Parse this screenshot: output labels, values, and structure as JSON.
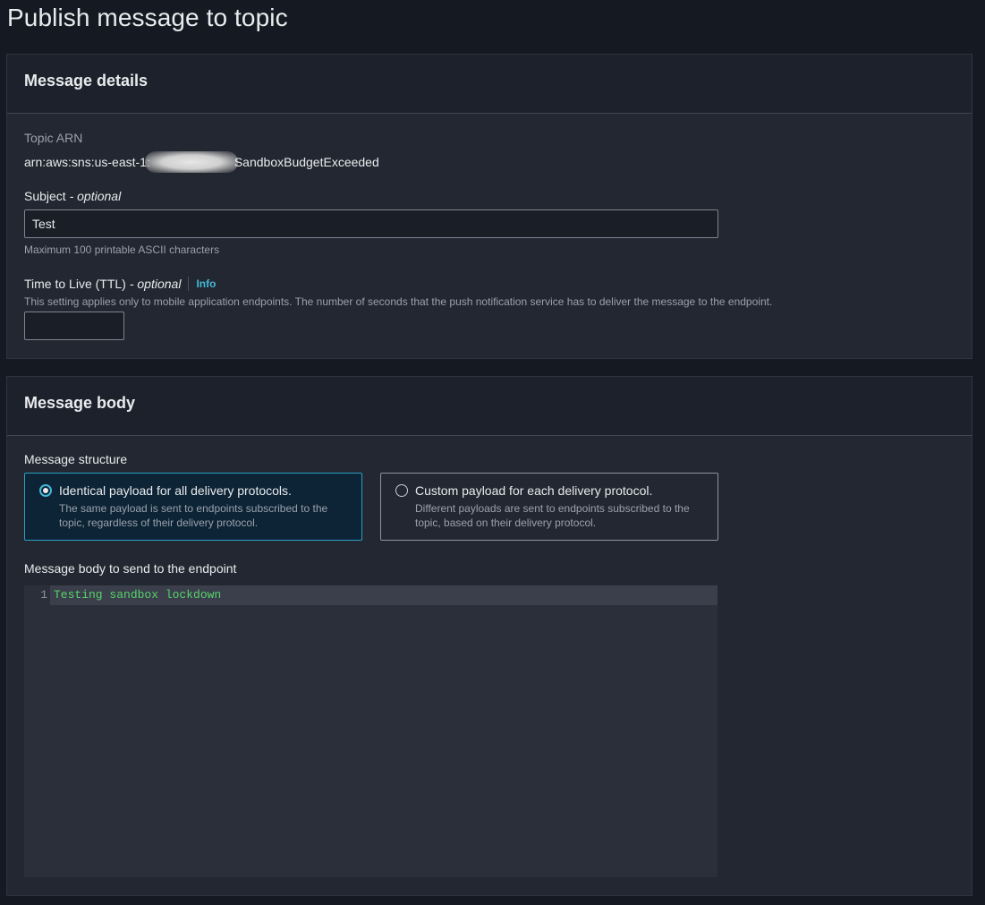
{
  "page": {
    "title": "Publish message to topic"
  },
  "message_details": {
    "heading": "Message details",
    "topic_arn": {
      "label": "Topic ARN",
      "prefix": "arn:aws:sns:us-east-1:",
      "suffix": "SandboxBudgetExceeded"
    },
    "subject": {
      "label": "Subject",
      "optional": "- optional",
      "value": "Test",
      "hint": "Maximum 100 printable ASCII characters"
    },
    "ttl": {
      "label": "Time to Live (TTL)",
      "optional": "- optional",
      "info_link": "Info",
      "description": "This setting applies only to mobile application endpoints. The number of seconds that the push notification service has to deliver the message to the endpoint.",
      "value": ""
    }
  },
  "message_body": {
    "heading": "Message body",
    "structure": {
      "label": "Message structure",
      "options": [
        {
          "title": "Identical payload for all delivery protocols.",
          "description": "The same payload is sent to endpoints subscribed to the topic, regardless of their delivery protocol.",
          "selected": true
        },
        {
          "title": "Custom payload for each delivery protocol.",
          "description": "Different payloads are sent to endpoints subscribed to the topic, based on their delivery protocol.",
          "selected": false
        }
      ]
    },
    "editor": {
      "label": "Message body to send to the endpoint",
      "line_number": "1",
      "content": "Testing sandbox lockdown"
    }
  },
  "colors": {
    "accent": "#44b9d6",
    "selected_tile_bg": "#0d2436",
    "code_text": "#58d26b"
  }
}
